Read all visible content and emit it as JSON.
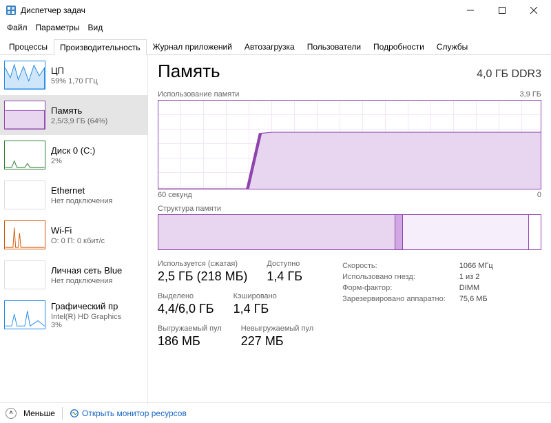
{
  "window": {
    "title": "Диспетчер задач"
  },
  "menu": {
    "file": "Файл",
    "options": "Параметры",
    "view": "Вид"
  },
  "tabs": {
    "processes": "Процессы",
    "performance": "Производительность",
    "apphistory": "Журнал приложений",
    "startup": "Автозагрузка",
    "users": "Пользователи",
    "details": "Подробности",
    "services": "Службы"
  },
  "sidebar": [
    {
      "title": "ЦП",
      "sub": "59%  1,70 ГГц",
      "color": "#1e88e5"
    },
    {
      "title": "Память",
      "sub": "2,5/3,9 ГБ (64%)",
      "color": "#8e44ad",
      "selected": true
    },
    {
      "title": "Диск 0 (C:)",
      "sub": "2%",
      "color": "#2e7d32"
    },
    {
      "title": "Ethernet",
      "sub": "Нет подключения",
      "color": "#bbb"
    },
    {
      "title": "Wi-Fi",
      "sub": "О: 0  П: 0 кбит/с",
      "color": "#d35400"
    },
    {
      "title": "Личная сеть Blue",
      "sub": "Нет подключения",
      "color": "#bbb"
    },
    {
      "title": "Графический пр",
      "sub": "Intel(R) HD Graphics\n3%",
      "color": "#1e88e5"
    }
  ],
  "main": {
    "heading": "Память",
    "right": "4,0 ГБ DDR3",
    "usage_label": "Использование памяти",
    "usage_max": "3,9 ГБ",
    "xaxis_left": "60 секунд",
    "xaxis_right": "0",
    "composition_label": "Структура памяти",
    "stats": {
      "inuse_lbl": "Используется (сжатая)",
      "inuse_val": "2,5 ГБ (218 МБ)",
      "avail_lbl": "Доступно",
      "avail_val": "1,4 ГБ",
      "commit_lbl": "Выделено",
      "commit_val": "4,4/6,0 ГБ",
      "cached_lbl": "Кэшировано",
      "cached_val": "1,4 ГБ",
      "paged_lbl": "Выгружаемый пул",
      "paged_val": "186 МБ",
      "nonpaged_lbl": "Невыгружаемый пул",
      "nonpaged_val": "227 МБ"
    },
    "details": {
      "speed_lbl": "Скорость:",
      "speed_val": "1066 МГц",
      "slots_lbl": "Использовано гнезд:",
      "slots_val": "1 из 2",
      "form_lbl": "Форм-фактор:",
      "form_val": "DIMM",
      "reserved_lbl": "Зарезервировано аппаратно:",
      "reserved_val": "75,6 МБ"
    }
  },
  "footer": {
    "less": "Меньше",
    "resmon": "Открыть монитор ресурсов"
  },
  "chart_data": {
    "type": "line",
    "title": "Использование памяти",
    "xlabel": "секунд",
    "ylabel": "ГБ",
    "xlim": [
      60,
      0
    ],
    "ylim": [
      0,
      3.9
    ],
    "x": [
      60,
      55,
      50,
      48,
      46,
      44,
      42,
      40,
      35,
      30,
      25,
      20,
      15,
      10,
      5,
      0
    ],
    "values": [
      0,
      0,
      0,
      0,
      0,
      2.45,
      2.5,
      2.5,
      2.5,
      2.5,
      2.5,
      2.5,
      2.5,
      2.5,
      2.5,
      2.5
    ]
  }
}
